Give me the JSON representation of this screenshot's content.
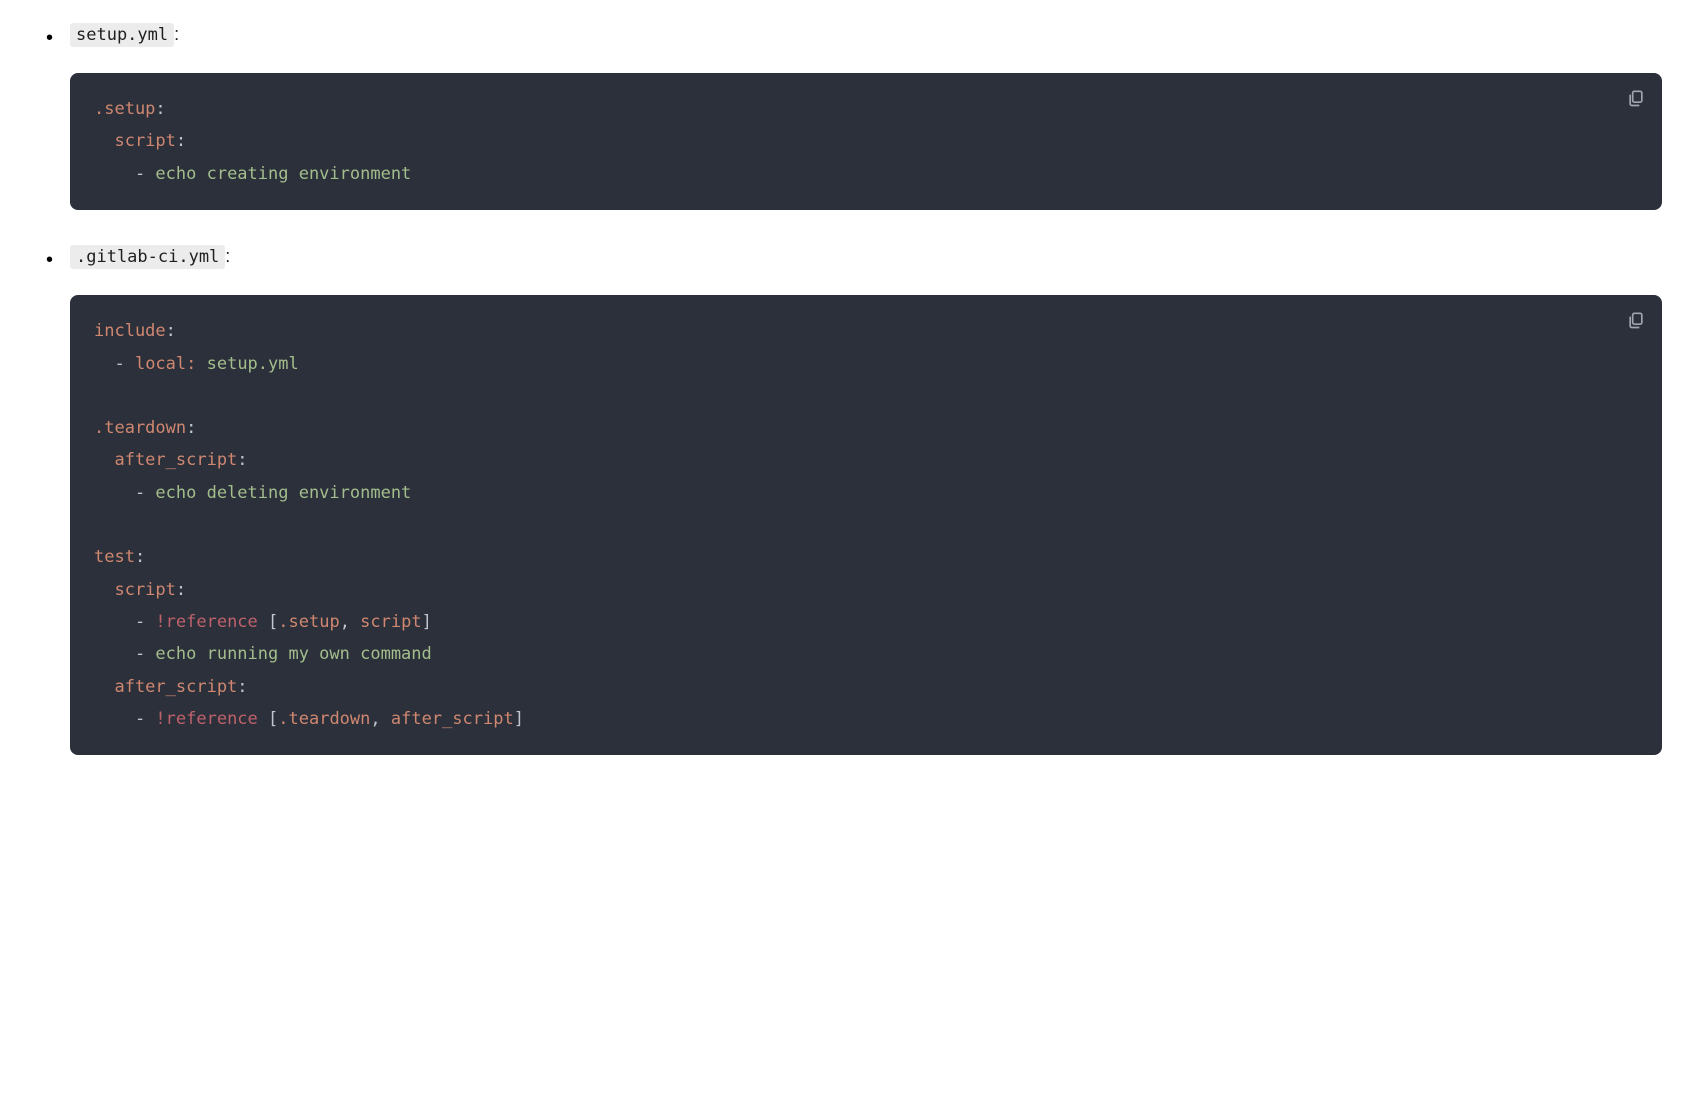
{
  "items": [
    {
      "filename": "setup.yml",
      "suffix": ":",
      "code": [
        [
          {
            "t": ".setup",
            "c": "tok-key"
          },
          {
            "t": ":",
            "c": "tok-colon"
          }
        ],
        [
          {
            "t": "  script",
            "c": "tok-key"
          },
          {
            "t": ":",
            "c": "tok-colon"
          }
        ],
        [
          {
            "t": "    - ",
            "c": "tok-dash"
          },
          {
            "t": "echo creating environment",
            "c": "tok-str"
          }
        ]
      ]
    },
    {
      "filename": ".gitlab-ci.yml",
      "suffix": ":",
      "code": [
        [
          {
            "t": "include",
            "c": "tok-key"
          },
          {
            "t": ":",
            "c": "tok-colon"
          }
        ],
        [
          {
            "t": "  - ",
            "c": "tok-dash"
          },
          {
            "t": "local: ",
            "c": "tok-key"
          },
          {
            "t": "setup.yml",
            "c": "tok-str"
          }
        ],
        [],
        [
          {
            "t": ".teardown",
            "c": "tok-key"
          },
          {
            "t": ":",
            "c": "tok-colon"
          }
        ],
        [
          {
            "t": "  after_script",
            "c": "tok-key"
          },
          {
            "t": ":",
            "c": "tok-colon"
          }
        ],
        [
          {
            "t": "    - ",
            "c": "tok-dash"
          },
          {
            "t": "echo deleting environment",
            "c": "tok-str"
          }
        ],
        [],
        [
          {
            "t": "test",
            "c": "tok-key"
          },
          {
            "t": ":",
            "c": "tok-colon"
          }
        ],
        [
          {
            "t": "  script",
            "c": "tok-key"
          },
          {
            "t": ":",
            "c": "tok-colon"
          }
        ],
        [
          {
            "t": "    - ",
            "c": "tok-dash"
          },
          {
            "t": "!reference ",
            "c": "tok-ref"
          },
          {
            "t": "[",
            "c": "tok-punc"
          },
          {
            "t": ".setup",
            "c": "tok-lbl"
          },
          {
            "t": ", ",
            "c": "tok-punc"
          },
          {
            "t": "script",
            "c": "tok-lbl"
          },
          {
            "t": "]",
            "c": "tok-punc"
          }
        ],
        [
          {
            "t": "    - ",
            "c": "tok-dash"
          },
          {
            "t": "echo running my own command",
            "c": "tok-str"
          }
        ],
        [
          {
            "t": "  after_script",
            "c": "tok-key"
          },
          {
            "t": ":",
            "c": "tok-colon"
          }
        ],
        [
          {
            "t": "    - ",
            "c": "tok-dash"
          },
          {
            "t": "!reference ",
            "c": "tok-ref"
          },
          {
            "t": "[",
            "c": "tok-punc"
          },
          {
            "t": ".teardown",
            "c": "tok-lbl"
          },
          {
            "t": ", ",
            "c": "tok-punc"
          },
          {
            "t": "after_script",
            "c": "tok-lbl"
          },
          {
            "t": "]",
            "c": "tok-punc"
          }
        ]
      ]
    }
  ],
  "copy_label": "Copy"
}
